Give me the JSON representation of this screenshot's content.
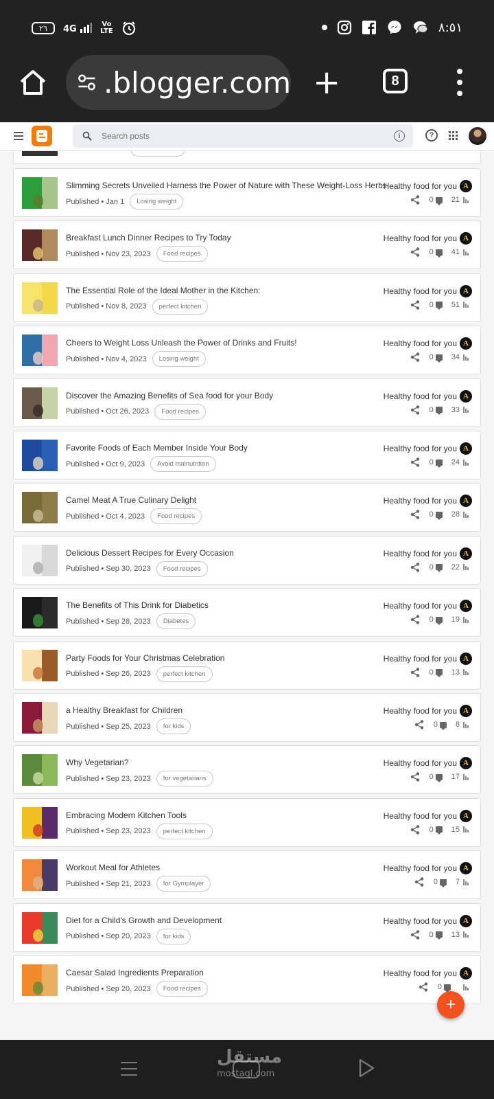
{
  "status_bar": {
    "battery": "٢٦",
    "network": "4G",
    "volte": "Vo\nLTE",
    "time": "٨:٥١"
  },
  "browser": {
    "url": ".blogger.com",
    "tab_count": "8"
  },
  "header": {
    "search_placeholder": "Search posts"
  },
  "posts": [
    {
      "title": "Slimming Secrets Unveiled Harness the Power of Nature with These Weight-Loss Herbs",
      "status": "Published • Jan 1",
      "label": "Losing weight",
      "blog": "Healthy food for you",
      "comments": "0",
      "views": "21",
      "thumb": [
        "#2e9e3c",
        "#a7c58a",
        "#5a7d2e"
      ]
    },
    {
      "title": "Breakfast Lunch Dinner Recipes to Try Today",
      "status": "Published • Nov 23, 2023",
      "label": "Food recipes",
      "blog": "Healthy food for you",
      "comments": "0",
      "views": "41",
      "thumb": [
        "#5a2a2a",
        "#b08a5c",
        "#e0c070"
      ]
    },
    {
      "title": "The Essential Role of the Ideal Mother in the Kitchen:",
      "status": "Published • Nov 8, 2023",
      "label": "perfect kitchen",
      "blog": "Healthy food for you",
      "comments": "0",
      "views": "51",
      "thumb": [
        "#f7e36a",
        "#f3d84a",
        "#c9b58a"
      ]
    },
    {
      "title": "Cheers to Weight Loss Unleash the Power of Drinks and Fruits!",
      "status": "Published • Nov 4, 2023",
      "label": "Losing weight",
      "blog": "Healthy food for you",
      "comments": "0",
      "views": "34",
      "thumb": [
        "#2f6fa8",
        "#f2a7b0",
        "#e8c8c8"
      ]
    },
    {
      "title": "Discover the Amazing Benefits of Sea food for your Body",
      "status": "Published • Oct 26, 2023",
      "label": "Food recipes",
      "blog": "Healthy food for you",
      "comments": "0",
      "views": "33",
      "thumb": [
        "#6a5a4a",
        "#c8d0a8",
        "#3a3028"
      ]
    },
    {
      "title": "Favorite Foods of Each Member Inside Your Body",
      "status": "Published • Oct 9, 2023",
      "label": "Avoid malnutrition",
      "blog": "Healthy food for you",
      "comments": "0",
      "views": "24",
      "thumb": [
        "#1e4aa0",
        "#2a5fb8",
        "#d8d0c0"
      ]
    },
    {
      "title": "Camel Meat A True Culinary Delight",
      "status": "Published • Oct 4, 2023",
      "label": "Food recipes",
      "blog": "Healthy food for you",
      "comments": "0",
      "views": "28",
      "thumb": [
        "#7a6a3a",
        "#8e7c48",
        "#c8b890"
      ]
    },
    {
      "title": "Delicious Dessert Recipes for Every Occasion",
      "status": "Published • Sep 30, 2023",
      "label": "Food recipes",
      "blog": "Healthy food for you",
      "comments": "0",
      "views": "22",
      "thumb": [
        "#f0f0f0",
        "#d8d8d8",
        "#b0b0b0"
      ]
    },
    {
      "title": "The Benefits of This Drink for Diabetics",
      "status": "Published • Sep 28, 2023",
      "label": "Diabetes",
      "blog": "Healthy food for you",
      "comments": "0",
      "views": "19",
      "thumb": [
        "#1a1a1a",
        "#2a2a2a",
        "#3a8a3a"
      ]
    },
    {
      "title": "Party Foods for Your Christmas Celebration",
      "status": "Published • Sep 26, 2023",
      "label": "perfect kitchen",
      "blog": "Healthy food for you",
      "comments": "0",
      "views": "13",
      "thumb": [
        "#f8e0b0",
        "#9a5a2a",
        "#c87a3a"
      ]
    },
    {
      "title": "a Healthy Breakfast for Children",
      "status": "Published • Sep 25, 2023",
      "label": "for kids",
      "blog": "Healthy food for you",
      "comments": "0",
      "views": "8",
      "thumb": [
        "#8a1a3a",
        "#e8d8b8",
        "#c89060"
      ]
    },
    {
      "title": "Why Vegetarian?",
      "status": "Published • Sep 23, 2023",
      "label": "for vegetarians",
      "blog": "Healthy food for you",
      "comments": "0",
      "views": "17",
      "thumb": [
        "#5a8a3a",
        "#8ab85a",
        "#c8d8a0"
      ]
    },
    {
      "title": "Embracing Modern Kitchen Tools",
      "status": "Published • Sep 23, 2023",
      "label": "perfect kitchen",
      "blog": "Healthy food for you",
      "comments": "0",
      "views": "15",
      "thumb": [
        "#f0c020",
        "#5a2a6a",
        "#d04020"
      ]
    },
    {
      "title": "Workout Meal for Athletes",
      "status": "Published • Sep 21, 2023",
      "label": "for Gymplayer",
      "blog": "Healthy food for you",
      "comments": "0",
      "views": "7",
      "thumb": [
        "#f08a3a",
        "#4a3a6a",
        "#e0b080"
      ]
    },
    {
      "title": "Diet for a Child's Growth and Development",
      "status": "Published • Sep 20, 2023",
      "label": "for kids",
      "blog": "Healthy food for you",
      "comments": "0",
      "views": "13",
      "thumb": [
        "#e83a2a",
        "#3a8a5a",
        "#f0d040"
      ]
    },
    {
      "title": "Caesar Salad Ingredients Preparation",
      "status": "Published • Sep 20, 2023",
      "label": "Food recipes",
      "blog": "Healthy food for you",
      "comments": "0",
      "views": "",
      "thumb": [
        "#f08a2a",
        "#e8b060",
        "#6a8a3a"
      ]
    }
  ],
  "fab": {
    "label": "+"
  },
  "watermark": {
    "main": "مستقل",
    "sub": "mostaql.com"
  }
}
